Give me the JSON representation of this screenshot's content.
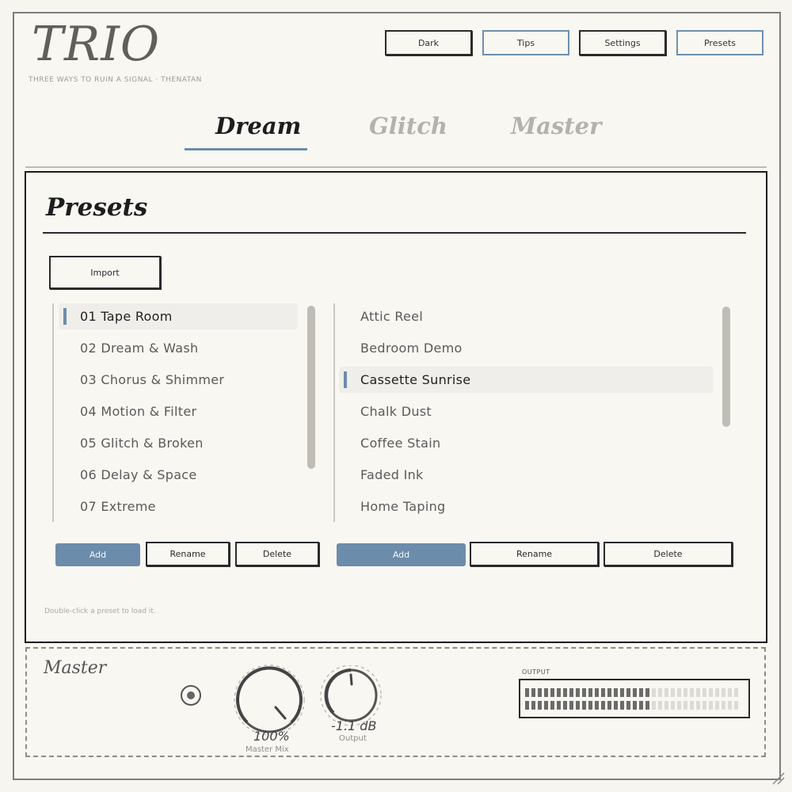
{
  "app": {
    "logo": "TRIO",
    "tagline": "THREE WAYS TO RUIN A SIGNAL  ·  THENATAN"
  },
  "header": {
    "buttons": [
      {
        "label": "Dark"
      },
      {
        "label": "Tips"
      },
      {
        "label": "Settings"
      },
      {
        "label": "Presets"
      }
    ]
  },
  "tabs": [
    {
      "label": "Dream",
      "active": true
    },
    {
      "label": "Glitch",
      "active": false
    },
    {
      "label": "Master",
      "active": false
    }
  ],
  "panel": {
    "title": "Presets",
    "import_label": "Import",
    "hint": "Double-click a preset to load it.",
    "categories": {
      "items": [
        "01 Tape Room",
        "02 Dream & Wash",
        "03 Chorus & Shimmer",
        "04 Motion & Filter",
        "05 Glitch & Broken",
        "06 Delay & Space",
        "07 Extreme"
      ],
      "selected": "01 Tape Room",
      "add_label": "Add",
      "rename_label": "Rename",
      "delete_label": "Delete"
    },
    "presets": {
      "items": [
        "Attic Reel",
        "Bedroom Demo",
        "Cassette Sunrise",
        "Chalk Dust",
        "Coffee Stain",
        "Faded Ink",
        "Home Taping"
      ],
      "selected": "Cassette Sunrise",
      "add_label": "Add",
      "rename_label": "Rename",
      "delete_label": "Delete"
    }
  },
  "master": {
    "title": "Master",
    "mix_value": "100%",
    "mix_label": "Master Mix",
    "mix_level": 1.0,
    "output_value": "-1.1 dB",
    "output_label": "Output",
    "meter_label": "OUTPUT",
    "meter_level": 0.6
  },
  "colors": {
    "accent": "#6c8cab",
    "ink": "#2a2a2a",
    "paper": "#f8f7f2"
  }
}
